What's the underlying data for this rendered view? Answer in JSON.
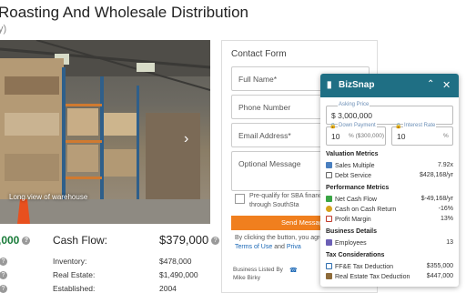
{
  "page": {
    "title": "Roasting And Wholesale Distribution",
    "subtitle": "y)",
    "photo_caption": "Long view of warehouse"
  },
  "stats": {
    "left_value": ",000",
    "cash_flow_label": "Cash Flow:",
    "cash_flow_value": "$379,000",
    "rows": [
      {
        "label": "Inventory:",
        "value": "$478,000"
      },
      {
        "label": "Real Estate:",
        "value": "$1,490,000"
      },
      {
        "label": "Established:",
        "value": "2004"
      }
    ]
  },
  "contact_form": {
    "title": "Contact Form",
    "full_name": "Full Name*",
    "phone": "Phone Number",
    "email": "Email Address*",
    "message": "Optional Message",
    "prequal": "Pre-qualify for SBA financing business through SouthSta",
    "send_button": "Send Message",
    "agree_text": "By clicking the button, you agree",
    "terms_link": "Terms of Use",
    "and_text": "and",
    "privacy_link": "Priva",
    "listed_by": "Business Listed By",
    "broker": "Mike Birky"
  },
  "bizsnap": {
    "title": "BizSnap",
    "asking_price_label": "Asking Price",
    "asking_price": "3,000,000",
    "currency": "$",
    "down_payment_label": "Down Payment",
    "down_payment": "10",
    "down_payment_unit": "% ($300,000)",
    "interest_rate_label": "Interest Rate",
    "interest_rate": "10",
    "interest_unit": "%",
    "sections": {
      "valuation": "Valuation Metrics",
      "performance": "Performance Metrics",
      "business": "Business Details",
      "tax": "Tax Considerations"
    },
    "valuation": [
      {
        "label": "Sales Multiple",
        "value": "7.92x"
      },
      {
        "label": "Debt Service",
        "value": "$428,168/yr"
      }
    ],
    "performance": [
      {
        "label": "Net Cash Flow",
        "value": "$-49,168/yr"
      },
      {
        "label": "Cash on Cash Return",
        "value": "-16%"
      },
      {
        "label": "Profit Margin",
        "value": "13%"
      }
    ],
    "business": [
      {
        "label": "Employees",
        "value": "13"
      }
    ],
    "tax": [
      {
        "label": "FF&E Tax Deduction",
        "value": "$355,000"
      },
      {
        "label": "Real Estate Tax Deduction",
        "value": "$447,000"
      }
    ]
  },
  "colors": {
    "accent": "#1f6f84",
    "cta": "#f07f1e",
    "link": "#1866b5",
    "positive": "#1a7c3a"
  }
}
